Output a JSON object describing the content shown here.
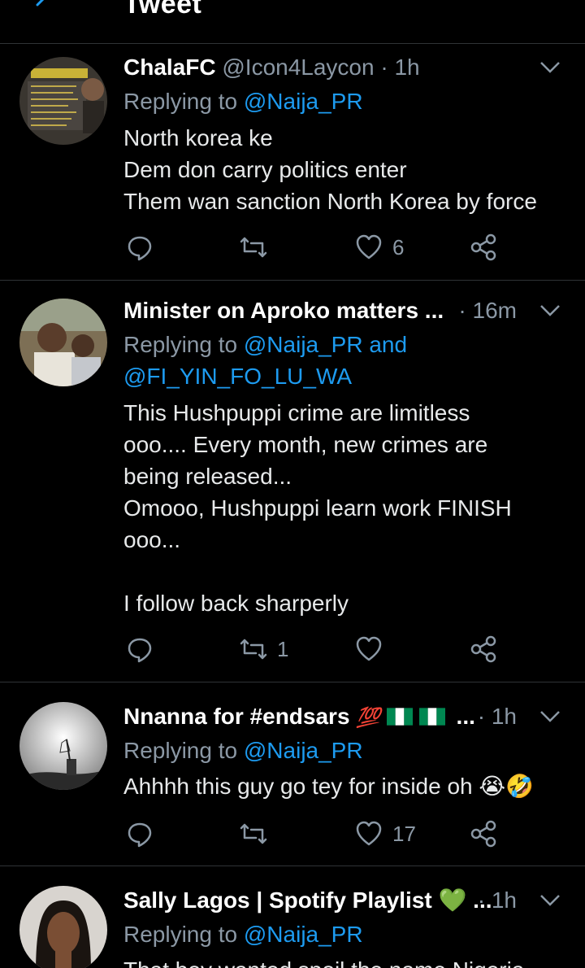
{
  "header": {
    "title": "Tweet"
  },
  "tweets": [
    {
      "name": "ChalaFC",
      "handle": "@Icon4Laycon",
      "time": "· 1h",
      "replying_prefix": "Replying to ",
      "replying_to": "@Naija_PR",
      "body": [
        "North korea ke",
        "Dem don carry politics enter",
        "Them wan sanction North Korea by force"
      ],
      "retweets": "",
      "likes": "6"
    },
    {
      "name": "Minister on Aproko matters ...",
      "time": "· 16m",
      "replying_prefix": "Replying to ",
      "replying_to": "@Naija_PR and",
      "replying_to_2": "@FI_YIN_FO_LU_WA",
      "body": [
        "This Hushpuppi crime are limitless",
        "ooo.... Every month, new crimes are",
        "being released...",
        "Omooo, Hushpuppi learn work FINISH",
        "ooo...",
        "",
        "I follow back sharperly"
      ],
      "retweets": "1",
      "likes": ""
    },
    {
      "name": "Nnanna for #endsars",
      "name_emoji": "💯",
      "name_suffix": "...",
      "time": "· 1h",
      "replying_prefix": "Replying to ",
      "replying_to": "@Naija_PR",
      "body": [
        "Ahhhh this guy go tey for inside oh"
      ],
      "body_emoji": "😭🤣",
      "retweets": "",
      "likes": "17"
    },
    {
      "name": "Sally Lagos | Spotify Playlist",
      "name_emoji": "💚",
      "name_suffix": "...",
      "time": "· 1h",
      "replying_prefix": "Replying to ",
      "replying_to": "@Naija_PR",
      "body": [
        "That boy wanted spoil the name Nigeria"
      ]
    }
  ],
  "colors": {
    "background": "#000000",
    "accent": "#1d9bf0",
    "muted": "#8b98a5",
    "divider": "#2f3336"
  },
  "icons": [
    "back-arrow-icon",
    "chevron-down-icon",
    "reply-icon",
    "retweet-icon",
    "like-icon",
    "share-icon",
    "nigeria-flag-icon"
  ]
}
